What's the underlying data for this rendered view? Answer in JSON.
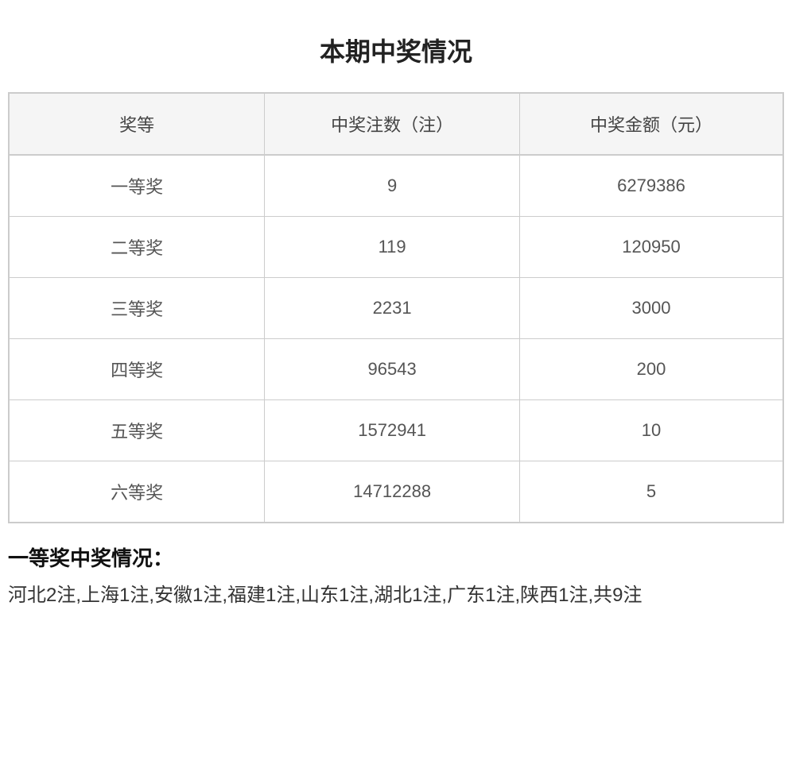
{
  "page": {
    "title": "本期中奖情况"
  },
  "table": {
    "headers": [
      "奖等",
      "中奖注数（注）",
      "中奖金额（元）"
    ],
    "rows": [
      {
        "prize_level": "一等奖",
        "count": "9",
        "amount": "6279386"
      },
      {
        "prize_level": "二等奖",
        "count": "119",
        "amount": "120950"
      },
      {
        "prize_level": "三等奖",
        "count": "2231",
        "amount": "3000"
      },
      {
        "prize_level": "四等奖",
        "count": "96543",
        "amount": "200"
      },
      {
        "prize_level": "五等奖",
        "count": "1572941",
        "amount": "10"
      },
      {
        "prize_level": "六等奖",
        "count": "14712288",
        "amount": "5"
      }
    ]
  },
  "first_prize_section": {
    "title": "一等奖中奖情况：",
    "content": "河北2注,上海1注,安徽1注,福建1注,山东1注,湖北1注,广东1注,陕西1注,共9注"
  }
}
